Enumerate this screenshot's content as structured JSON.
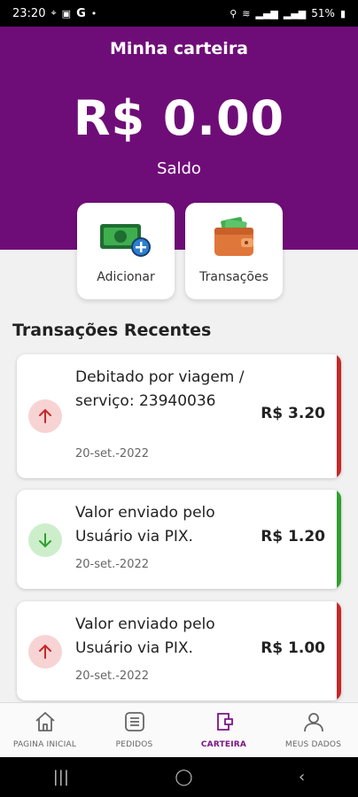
{
  "status_bar": {
    "time": "23:20",
    "left_icons": [
      "location-icon",
      "image-icon",
      "google-icon",
      "dot-icon"
    ],
    "battery": "51%"
  },
  "header": {
    "title": "Minha carteira",
    "amount": "R$ 0.00",
    "balance_label": "Saldo"
  },
  "actions": [
    {
      "label": "Adicionar",
      "icon": "add-money-icon"
    },
    {
      "label": "Transações",
      "icon": "wallet-icon"
    }
  ],
  "recent": {
    "title": "Transações Recentes",
    "items": [
      {
        "description": "Debitado por viagem / serviço: 23940036",
        "date": "20-set.-2022",
        "value": "R$ 3.20",
        "direction": "up",
        "color": "#c62828",
        "icon_bg": "#f8d3d3"
      },
      {
        "description": "Valor enviado pelo Usuário via PIX.",
        "date": "20-set.-2022",
        "value": "R$ 1.20",
        "direction": "down",
        "color": "#2ea02e",
        "icon_bg": "#cdeecb"
      },
      {
        "description": "Valor enviado pelo Usuário via PIX.",
        "date": "20-set.-2022",
        "value": "R$ 1.00",
        "direction": "up",
        "color": "#c62828",
        "icon_bg": "#f8d3d3"
      }
    ]
  },
  "bottom_nav": [
    {
      "label": "PAGINA INICIAL",
      "icon": "home-icon",
      "active": false
    },
    {
      "label": "PEDIDOS",
      "icon": "orders-icon",
      "active": false
    },
    {
      "label": "CARTEIRA",
      "icon": "wallet-icon",
      "active": true
    },
    {
      "label": "MEUS DADOS",
      "icon": "user-icon",
      "active": false
    }
  ],
  "colors": {
    "primary": "#6f0d78",
    "debit": "#c62828",
    "credit": "#2ea02e"
  }
}
